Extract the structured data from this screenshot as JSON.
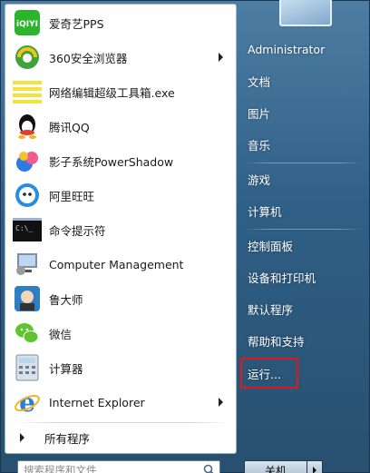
{
  "programs": [
    {
      "label": "爱奇艺PPS",
      "icon": "iqiyi-icon",
      "has_submenu": false
    },
    {
      "label": "360安全浏览器",
      "icon": "360-browser-icon",
      "has_submenu": true
    },
    {
      "label": "网络编辑超级工具箱.exe",
      "icon": "toolbox-icon",
      "has_submenu": false
    },
    {
      "label": "腾讯QQ",
      "icon": "qq-icon",
      "has_submenu": false
    },
    {
      "label": "影子系统PowerShadow",
      "icon": "powershadow-icon",
      "has_submenu": false
    },
    {
      "label": "阿里旺旺",
      "icon": "aliwangwang-icon",
      "has_submenu": false
    },
    {
      "label": "命令提示符",
      "icon": "cmd-icon",
      "has_submenu": false
    },
    {
      "label": "Computer Management",
      "icon": "computer-management-icon",
      "has_submenu": false
    },
    {
      "label": "鲁大师",
      "icon": "ludashi-icon",
      "has_submenu": false
    },
    {
      "label": "微信",
      "icon": "wechat-icon",
      "has_submenu": false
    },
    {
      "label": "计算器",
      "icon": "calculator-icon",
      "has_submenu": false
    },
    {
      "label": "Internet Explorer",
      "icon": "ie-icon",
      "has_submenu": true
    }
  ],
  "all_programs_label": "所有程序",
  "search_placeholder": "搜索程序和文件",
  "right_panel": {
    "username": "Administrator",
    "items": [
      "文档",
      "图片",
      "音乐",
      "游戏",
      "计算机",
      "控制面板",
      "设备和打印机",
      "默认程序",
      "帮助和支持",
      "运行..."
    ],
    "highlighted_item": "运行..."
  },
  "shutdown_label": "关机",
  "colors": {
    "menu_blue": "#2f5f86",
    "highlight_red": "#e0171b",
    "left_panel_bg": "#ffffff"
  }
}
